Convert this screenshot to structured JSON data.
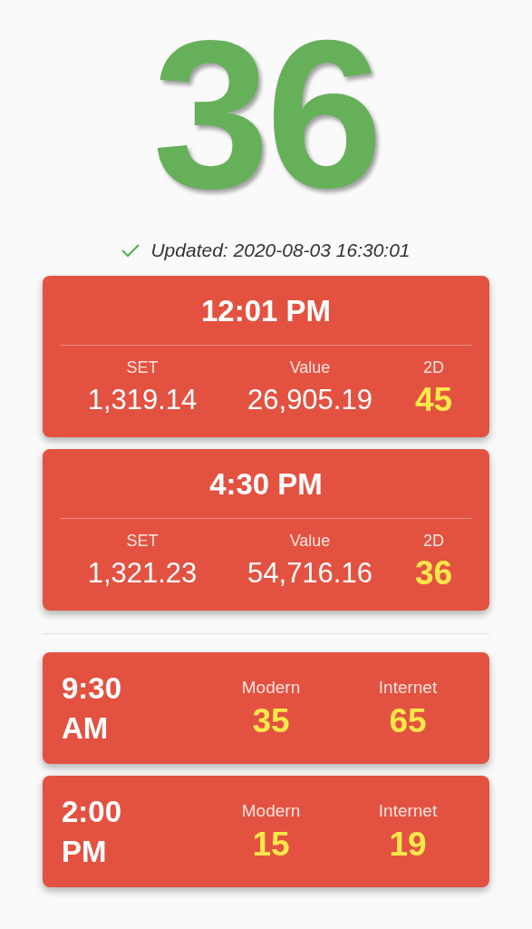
{
  "big_number": "36",
  "updated": {
    "ok": true,
    "text": "Updated: 2020-08-03 16:30:01"
  },
  "sessions": [
    {
      "time": "12:01 PM",
      "set_label": "SET",
      "set": "1,319.14",
      "value_label": "Value",
      "value": "26,905.19",
      "twod_label": "2D",
      "twod": "45"
    },
    {
      "time": "4:30 PM",
      "set_label": "SET",
      "set": "1,321.23",
      "value_label": "Value",
      "value": "54,716.16",
      "twod_label": "2D",
      "twod": "36"
    }
  ],
  "internet_results": [
    {
      "time": "9:30 AM",
      "modern_label": "Modern",
      "modern": "35",
      "internet_label": "Internet",
      "internet": "65"
    },
    {
      "time": "2:00 PM",
      "modern_label": "Modern",
      "modern": "15",
      "internet_label": "Internet",
      "internet": "19"
    }
  ]
}
